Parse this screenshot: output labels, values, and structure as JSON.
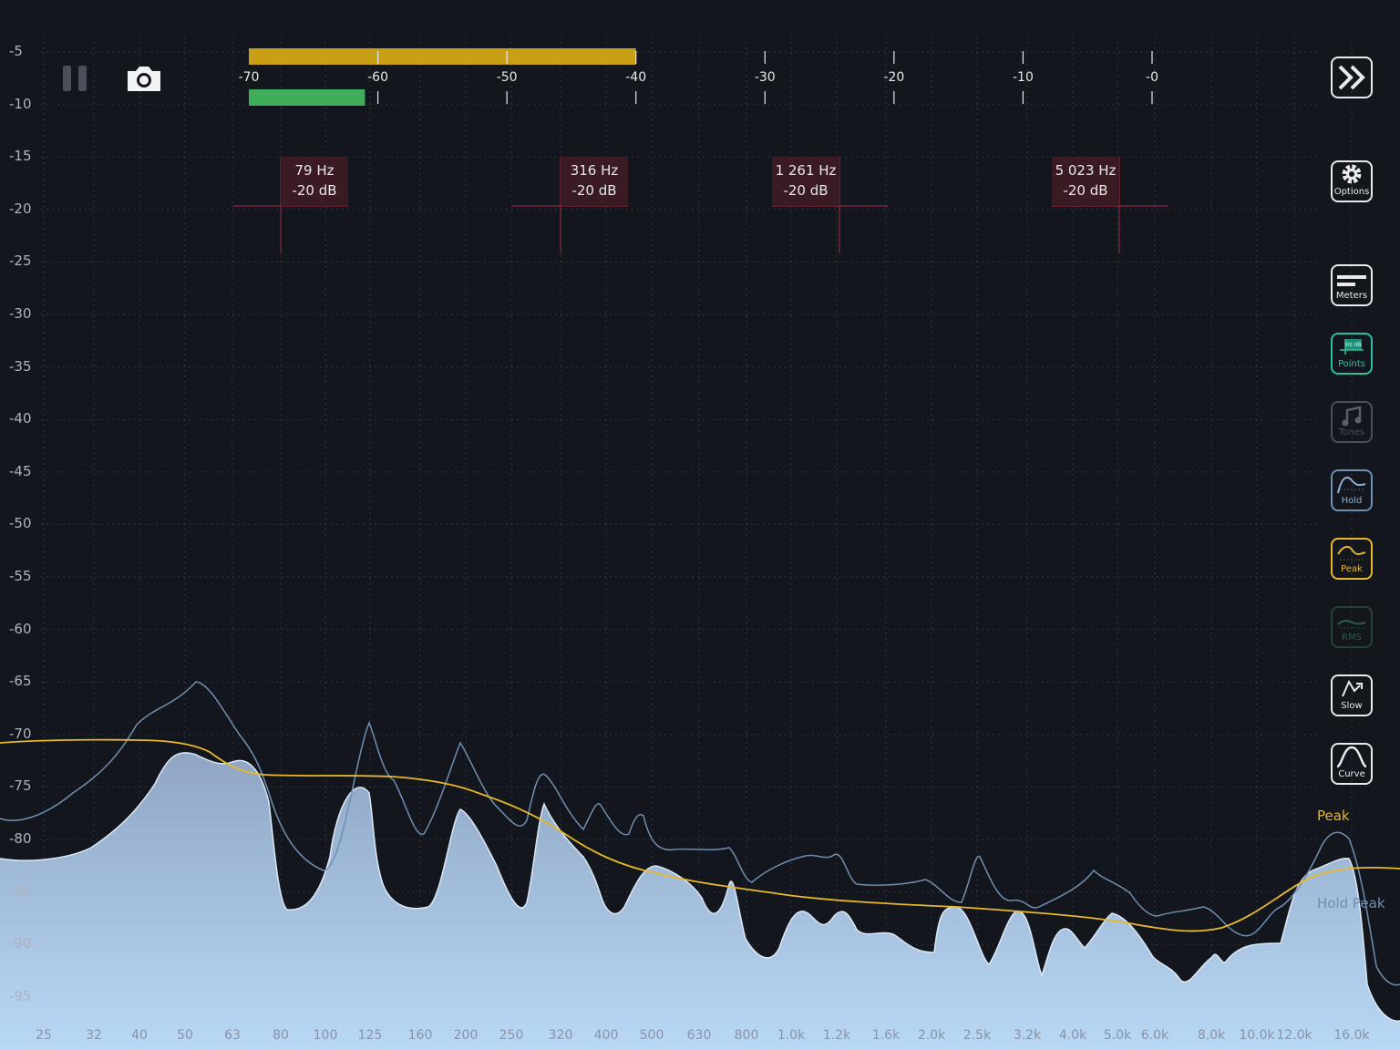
{
  "y_axis": [
    "-5",
    "-10",
    "-15",
    "-20",
    "-25",
    "-30",
    "-35",
    "-40",
    "-45",
    "-50",
    "-55",
    "-60",
    "-65",
    "-70",
    "-75",
    "-80",
    "-85",
    "-90",
    "-95"
  ],
  "x_axis": [
    "25",
    "32",
    "40",
    "50",
    "63",
    "80",
    "100",
    "125",
    "160",
    "200",
    "250",
    "320",
    "400",
    "500",
    "630",
    "800",
    "1.0k",
    "1.2k",
    "1.6k",
    "2.0k",
    "2.5k",
    "3.2k",
    "4.0k",
    "5.0k",
    "6.0k",
    "8.0k",
    "10.0k",
    "12.0k",
    "16.0k"
  ],
  "level_scale": [
    "-70",
    "-60",
    "-50",
    "-40",
    "-30",
    "-20",
    "-10",
    "-0"
  ],
  "level_meter": {
    "peak_db": -40,
    "rms_db": -61,
    "peak_color": "#c9a015",
    "rms_color": "#3fae5a"
  },
  "markers": [
    {
      "freq": "79 Hz",
      "db": "-20 dB"
    },
    {
      "freq": "316 Hz",
      "db": "-20 dB"
    },
    {
      "freq": "1 261 Hz",
      "db": "-20 dB"
    },
    {
      "freq": "5 023 Hz",
      "db": "-20 dB"
    }
  ],
  "buttons": {
    "pause_icon": "pause-icon",
    "camera_icon": "camera-icon",
    "forward_icon": "fast-forward-icon",
    "options": "Options",
    "meters": "Meters",
    "points": "Points",
    "points_icon_text": "Hz dB",
    "tones": "Tones",
    "hold": "Hold",
    "peak": "Peak",
    "rms": "RMS",
    "slow": "Slow",
    "curve": "Curve"
  },
  "curve_labels": {
    "peak": "Peak",
    "hold_peak": "Hold Peak"
  },
  "colors": {
    "background": "#13161d",
    "peak": "#e6b82a",
    "hold": "#6f8fb3",
    "spectrum_top": "#8fa6c4",
    "spectrum_bottom": "#b9d8f5",
    "accent_points": "#2cc0a0"
  }
}
